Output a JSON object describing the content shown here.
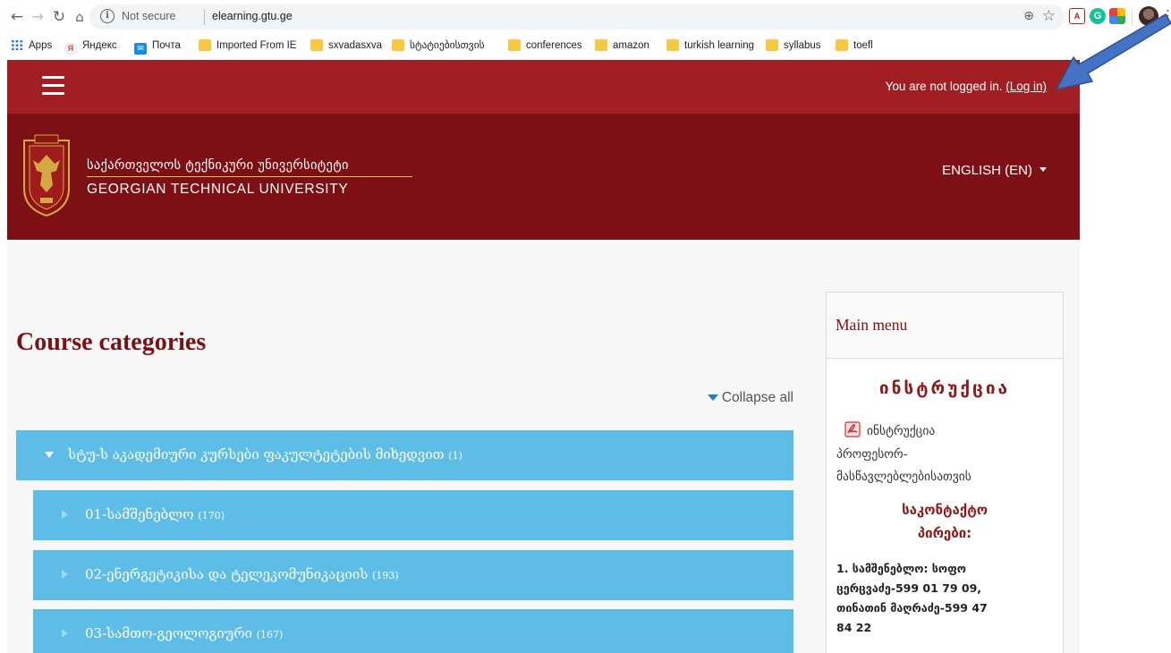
{
  "browser": {
    "omnibox": {
      "security_label": "Not secure",
      "url": "elearning.gtu.ge"
    },
    "icons": [
      "back-icon",
      "forward-icon",
      "reload-icon",
      "home-icon",
      "info-icon",
      "zoom-icon",
      "star-icon",
      "pdf-extension-icon",
      "grammarly-icon",
      "color-extension-icon",
      "profile-avatar",
      "kebab-menu-icon"
    ],
    "bookmarks": [
      {
        "label": "Apps",
        "icon": "apps-grid-icon"
      },
      {
        "label": "Яндекс",
        "icon": "yandex-icon"
      },
      {
        "label": "Почта",
        "icon": "mail-icon"
      },
      {
        "label": "Imported From IE",
        "icon": "folder-icon"
      },
      {
        "label": "sxvadasxva",
        "icon": "folder-icon"
      },
      {
        "label": "სტატიებისთვის",
        "icon": "folder-icon"
      },
      {
        "label": "conferences",
        "icon": "folder-icon"
      },
      {
        "label": "amazon",
        "icon": "folder-icon"
      },
      {
        "label": "turkish learning",
        "icon": "folder-icon"
      },
      {
        "label": "syllabus",
        "icon": "folder-icon"
      },
      {
        "label": "toefl",
        "icon": "folder-icon"
      }
    ]
  },
  "header": {
    "login_prefix": "You are not logged in. ",
    "login_link": "(Log in)",
    "brand_georgian": "საქართველოს ტექნიკური უნივერსიტეტი",
    "brand_english": "GEORGIAN TECHNICAL UNIVERSITY",
    "language": "ENGLISH (EN)"
  },
  "colors": {
    "topbar": "#a11f23",
    "brandbar": "#7d1014",
    "category": "#5dbde6",
    "title": "#7d1014",
    "annotation_arrow": "#4472c4"
  },
  "main": {
    "title": "Course categories",
    "collapse_all": "Collapse all",
    "categories": [
      {
        "label": "სტუ-ს აკადემიური კურსები ფაკულტეტების მიხედვით",
        "count": "(1)",
        "expanded": true
      },
      {
        "label": "01-სამშენებლო",
        "count": "(170)",
        "expanded": false
      },
      {
        "label": "02-ენერგეტიკისა და ტელეკომუნიკაციის",
        "count": "(193)",
        "expanded": false
      },
      {
        "label": "03-სამთო-გეოლოგიური",
        "count": "(167)",
        "expanded": false
      }
    ]
  },
  "sidebar": {
    "title": "Main menu",
    "instruction_heading": "ინსტრუქცია",
    "instruction_link_line1": "ინსტრუქცია",
    "instruction_link_line2": "პროფესორ-",
    "instruction_link_line3": "მასწავლებლებისათვის",
    "contacts_line1": "საკონტაქტო",
    "contacts_line2": "პირები:",
    "contact_lines": [
      "1. სამშენებლო: სოფო",
      "ცერცვაძე-599 01 79  09,",
      "თინათინ მაღრაძე-599 47",
      "84 22"
    ]
  }
}
